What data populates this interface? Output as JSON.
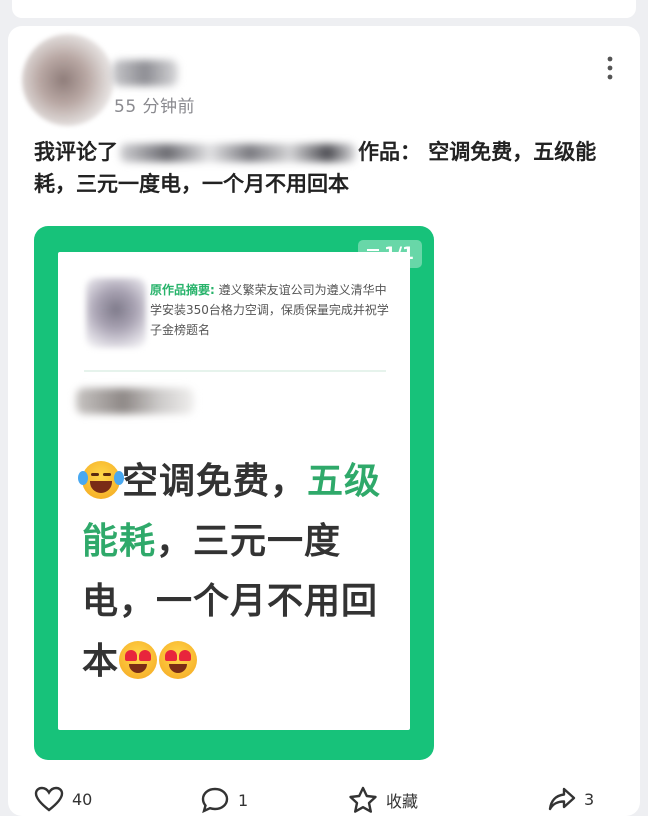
{
  "post": {
    "time": "55 分钟前",
    "caption_prefix": "我评论了",
    "caption_suffix": "作品：  空调免费，五级能耗，三元一度电，一个月不用回本"
  },
  "work_card": {
    "page_badge": "1/1",
    "summary_label": "原作品摘要:",
    "summary_text": "遵义繁荣友谊公司为遵义清华中学安装350台格力空调，保质保量完成并祝学子金榜题名",
    "comment_part1": "空调免费，",
    "comment_highlight": "五级能耗",
    "comment_part2": "，三元一度电，一个月不用回本"
  },
  "actions": {
    "like_count": "40",
    "comment_count": "1",
    "favorite_label": "收藏",
    "share_count": "3"
  },
  "colors": {
    "brand_green": "#17c27a",
    "highlight_green": "#2fa96a",
    "background": "#eeeff2"
  }
}
